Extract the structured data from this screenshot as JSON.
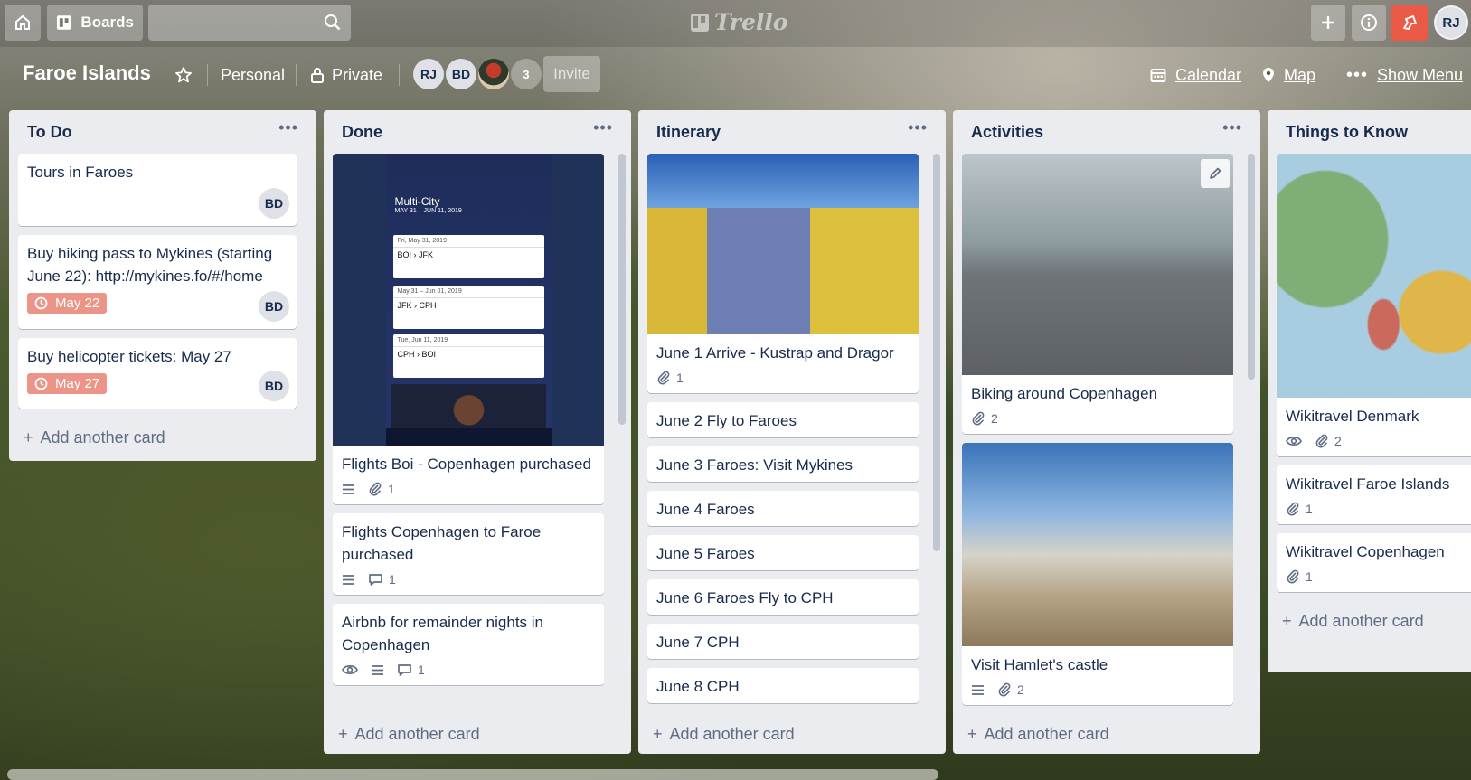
{
  "header": {
    "boards_label": "Boards",
    "search_placeholder": "",
    "logo_text": "Trello",
    "user_initials": "RJ"
  },
  "board": {
    "title": "Faroe Islands",
    "team": "Personal",
    "visibility": "Private",
    "members": [
      "RJ",
      "BD"
    ],
    "member_count": "3",
    "invite_label": "Invite",
    "calendar_label": "Calendar",
    "map_label": "Map",
    "show_menu_label": "Show Menu"
  },
  "lists": [
    {
      "title": "To Do",
      "add_label": "Add another card",
      "cards": [
        {
          "title": "Tours in Faroes",
          "member": "BD"
        },
        {
          "title": "Buy hiking pass to Mykines (starting June 22): http://mykines.fo/#/home",
          "due": "May 22",
          "member": "BD"
        },
        {
          "title": "Buy helicopter tickets: May 27",
          "due": "May 27",
          "member": "BD"
        }
      ]
    },
    {
      "title": "Done",
      "add_label": "Add another card",
      "cover_text": {
        "heading": "Multi-City",
        "dates": "MAY 31 – JUN 11, 2019",
        "legs": [
          {
            "date": "Fri, May 31, 2019",
            "route": "BOI › JFK"
          },
          {
            "date": "May 31 – Jun 01, 2019",
            "route": "JFK › CPH"
          },
          {
            "date": "Tue, Jun 11, 2019",
            "route": "CPH › BOI"
          }
        ]
      },
      "cards": [
        {
          "title": "Flights Boi - Copenhagen purchased",
          "attachments": "1"
        },
        {
          "title": "Flights Copenhagen to Faroe purchased",
          "comments": "1"
        },
        {
          "title": "Airbnb for remainder nights in Copenhagen",
          "comments": "1"
        }
      ]
    },
    {
      "title": "Itinerary",
      "add_label": "Add another card",
      "cards": [
        {
          "title": "June 1 Arrive - Kustrap and Dragor",
          "attachments": "1"
        },
        {
          "title": "June 2 Fly to Faroes"
        },
        {
          "title": "June 3 Faroes: Visit Mykines"
        },
        {
          "title": "June 4 Faroes"
        },
        {
          "title": "June 5 Faroes"
        },
        {
          "title": "June 6 Faroes Fly to CPH"
        },
        {
          "title": "June 7 CPH"
        },
        {
          "title": "June 8 CPH"
        }
      ]
    },
    {
      "title": "Activities",
      "add_label": "Add another card",
      "cards": [
        {
          "title": "Biking around Copenhagen",
          "attachments": "2"
        },
        {
          "title": "Visit Hamlet's castle",
          "attachments": "2"
        }
      ]
    },
    {
      "title": "Things to Know",
      "add_label": "Add another card",
      "cards": [
        {
          "title": "Wikitravel Denmark",
          "attachments": "2"
        },
        {
          "title": "Wikitravel Faroe Islands",
          "attachments": "1"
        },
        {
          "title": "Wikitravel Copenhagen",
          "attachments": "1"
        }
      ]
    }
  ],
  "colors": {
    "due_badge": "#ec9488",
    "notification": "#eb5a46",
    "list_bg": "#ebecf0"
  },
  "icons": [
    "home-icon",
    "boards-icon",
    "search-icon",
    "plus-icon",
    "info-icon",
    "notification-icon",
    "star-icon",
    "lock-icon",
    "calendar-icon",
    "map-pin-icon",
    "more-icon",
    "description-icon",
    "attachment-icon",
    "comment-icon",
    "watch-icon",
    "clock-icon",
    "pencil-icon"
  ]
}
